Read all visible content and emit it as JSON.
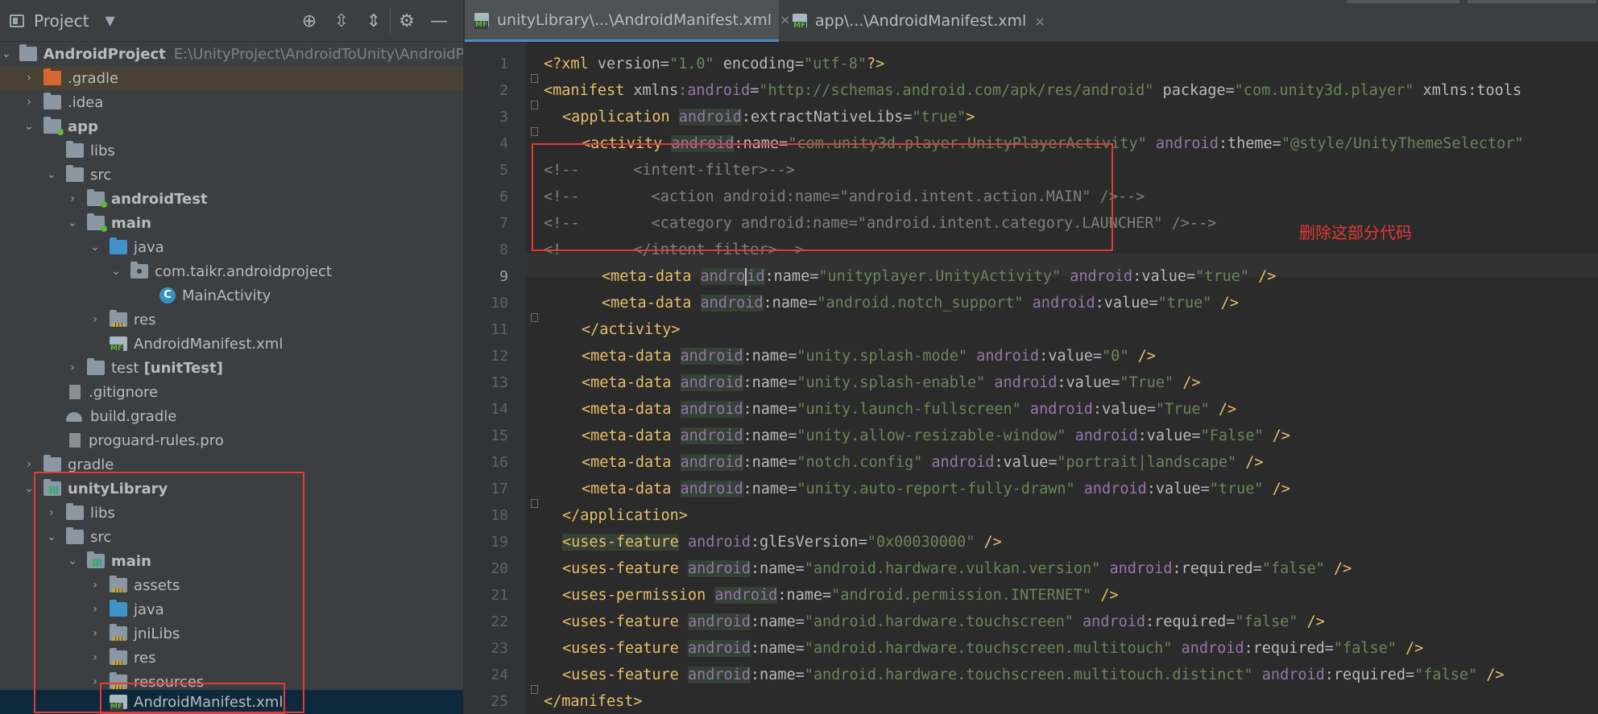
{
  "sidebar": {
    "title": "Project",
    "tree": [
      {
        "label": "AndroidProject",
        "path": "E:\\UnityProject\\AndroidToUnity\\AndroidProje"
      },
      {
        "label": ".gradle"
      },
      {
        "label": ".idea"
      },
      {
        "label": "app"
      },
      {
        "label": "libs"
      },
      {
        "label": "src"
      },
      {
        "label": "androidTest"
      },
      {
        "label": "main"
      },
      {
        "label": "java"
      },
      {
        "label": "com.taikr.androidproject"
      },
      {
        "label": "MainActivity"
      },
      {
        "label": "res"
      },
      {
        "label": "AndroidManifest.xml"
      },
      {
        "label": "test",
        "suffix": "[unitTest]"
      },
      {
        "label": ".gitignore"
      },
      {
        "label": "build.gradle"
      },
      {
        "label": "proguard-rules.pro"
      },
      {
        "label": "gradle"
      },
      {
        "label": "unityLibrary"
      },
      {
        "label": "libs"
      },
      {
        "label": "src"
      },
      {
        "label": "main"
      },
      {
        "label": "assets"
      },
      {
        "label": "java"
      },
      {
        "label": "jniLibs"
      },
      {
        "label": "res"
      },
      {
        "label": "resources"
      },
      {
        "label": "AndroidManifest.xml"
      }
    ]
  },
  "tabs": [
    {
      "label": "unityLibrary\\...\\AndroidManifest.xml",
      "close": "×"
    },
    {
      "label": "app\\...\\AndroidManifest.xml",
      "close": "×"
    }
  ],
  "line_numbers": [
    "1",
    "2",
    "3",
    "4",
    "5",
    "6",
    "7",
    "8",
    "9",
    "10",
    "11",
    "12",
    "13",
    "14",
    "15",
    "16",
    "17",
    "18",
    "19",
    "20",
    "21",
    "22",
    "23",
    "24",
    "25"
  ],
  "annotation": "删除这部分代码",
  "code": {
    "l1": {
      "pi": "<?xml ",
      "a1": "version",
      "v1": "\"1.0\"",
      "a2": " encoding",
      "v2": "\"utf-8\"",
      "end": "?>"
    },
    "l2": {
      "open": "<manifest ",
      "a1": "xmlns",
      "ns": ":android",
      "eq1": "=",
      "v1": "\"http://schemas.android.com/apk/res/android\"",
      "a2": " package",
      "eq2": "=",
      "v2": "\"com.unity3d.player\"",
      "a3": " xmlns:tools"
    },
    "l3": {
      "open": "<application ",
      "ns": "android",
      "a": ":extractNativeLibs",
      "eq": "=",
      "v": "\"true\"",
      "end": ">"
    },
    "l4": {
      "open": "<activity ",
      "ns1": "android",
      "a1": ":name",
      "eq1": "=",
      "v1": "\"com.unity3d.player.UnityPlayerActivity\"",
      "ns2": " android",
      "a2": ":theme",
      "eq2": "=",
      "v2": "\"@style/UnityThemeSelector\""
    },
    "l5": "<!--      <intent-filter>-->",
    "l6": "<!--        <action android:name=\"android.intent.action.MAIN\" />-->",
    "l7": "<!--        <category android:name=\"android.intent.category.LAUNCHER\" />-->",
    "l8": "<!--      </intent-filter>-->",
    "l9": {
      "open": "<meta-data ",
      "ns1a": "andro",
      "ns1b": "id",
      "a1": ":name",
      "eq1": "=",
      "v1": "\"unityplayer.UnityActivity\"",
      "ns2": " android",
      "a2": ":value",
      "eq2": "=",
      "v2": "\"true\"",
      "end": " />"
    },
    "l10": {
      "open": "<meta-data ",
      "ns1": "android",
      "a1": ":name",
      "eq1": "=",
      "v1": "\"android.notch_support\"",
      "ns2": " android",
      "a2": ":value",
      "eq2": "=",
      "v2": "\"true\"",
      "end": " />"
    },
    "l11": "</activity>",
    "l12": {
      "open": "<meta-data ",
      "ns1": "android",
      "a1": ":name",
      "eq1": "=",
      "v1": "\"unity.splash-mode\"",
      "ns2": " android",
      "a2": ":value",
      "eq2": "=",
      "v2": "\"0\"",
      "end": " />"
    },
    "l13": {
      "open": "<meta-data ",
      "ns1": "android",
      "a1": ":name",
      "eq1": "=",
      "v1": "\"unity.splash-enable\"",
      "ns2": " android",
      "a2": ":value",
      "eq2": "=",
      "v2": "\"True\"",
      "end": " />"
    },
    "l14": {
      "open": "<meta-data ",
      "ns1": "android",
      "a1": ":name",
      "eq1": "=",
      "v1": "\"unity.launch-fullscreen\"",
      "ns2": " android",
      "a2": ":value",
      "eq2": "=",
      "v2": "\"True\"",
      "end": " />"
    },
    "l15": {
      "open": "<meta-data ",
      "ns1": "android",
      "a1": ":name",
      "eq1": "=",
      "v1": "\"unity.allow-resizable-window\"",
      "ns2": " android",
      "a2": ":value",
      "eq2": "=",
      "v2": "\"False\"",
      "end": " />"
    },
    "l16": {
      "open": "<meta-data ",
      "ns1": "android",
      "a1": ":name",
      "eq1": "=",
      "v1": "\"notch.config\"",
      "ns2": " android",
      "a2": ":value",
      "eq2": "=",
      "v2": "\"portrait|landscape\"",
      "end": " />"
    },
    "l17": {
      "open": "<meta-data ",
      "ns1": "android",
      "a1": ":name",
      "eq1": "=",
      "v1": "\"unity.auto-report-fully-drawn\"",
      "ns2": " android",
      "a2": ":value",
      "eq2": "=",
      "v2": "\"true\"",
      "end": " />"
    },
    "l18": "</application>",
    "l19": {
      "open": "<uses-feature",
      "sp": " ",
      "ns": "android",
      "a": ":glEsVersion",
      "eq": "=",
      "v": "\"0x00030000\"",
      "end": " />"
    },
    "l20": {
      "open": "<uses-feature ",
      "ns1": "android",
      "a1": ":name",
      "eq1": "=",
      "v1": "\"android.hardware.vulkan.version\"",
      "ns2": " android",
      "a2": ":required",
      "eq2": "=",
      "v2": "\"false\"",
      "end": " />"
    },
    "l21": {
      "open": "<uses-permission ",
      "ns": "android",
      "a": ":name",
      "eq": "=",
      "v": "\"android.permission.INTERNET\"",
      "end": " />"
    },
    "l22": {
      "open": "<uses-feature ",
      "ns1": "android",
      "a1": ":name",
      "eq1": "=",
      "v1": "\"android.hardware.touchscreen\"",
      "ns2": " android",
      "a2": ":required",
      "eq2": "=",
      "v2": "\"false\"",
      "end": " />"
    },
    "l23": {
      "open": "<uses-feature ",
      "ns1": "android",
      "a1": ":name",
      "eq1": "=",
      "v1": "\"android.hardware.touchscreen.multitouch\"",
      "ns2": " android",
      "a2": ":required",
      "eq2": "=",
      "v2": "\"false\"",
      "end": " />"
    },
    "l24": {
      "open": "<uses-feature ",
      "ns1": "android",
      "a1": ":name",
      "eq1": "=",
      "v1": "\"android.hardware.touchscreen.multitouch.distinct\"",
      "ns2": " android",
      "a2": ":required",
      "eq2": "=",
      "v2": "\"false\"",
      "end": " />"
    },
    "l25": "</manifest>"
  },
  "colors": {
    "accent": "#4a88c7",
    "annotation_red": "#e53935",
    "tag": "#e8bf6a",
    "attr_ns": "#9876aa",
    "string": "#6a8759",
    "comment": "#808080"
  }
}
